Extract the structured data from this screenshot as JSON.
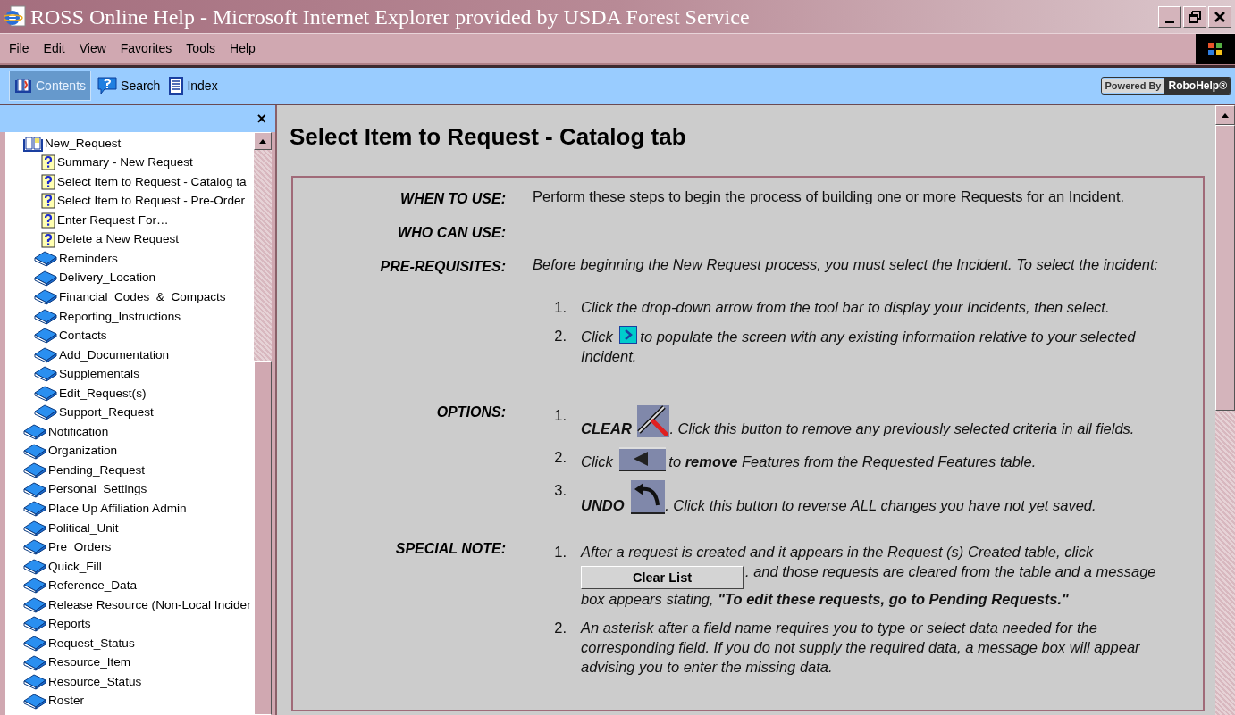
{
  "window": {
    "title": "ROSS Online Help - Microsoft Internet Explorer provided by USDA Forest Service"
  },
  "menu": [
    "File",
    "Edit",
    "View",
    "Favorites",
    "Tools",
    "Help"
  ],
  "tabs": [
    {
      "label": "Contents",
      "selected": true
    },
    {
      "label": "Search",
      "selected": false
    },
    {
      "label": "Index",
      "selected": false
    }
  ],
  "badge": {
    "left": "Powered By",
    "right": "RoboHelp®"
  },
  "sidebar": {
    "close": "×",
    "items": [
      {
        "label": "New_Request",
        "kind": "book",
        "expanded": true,
        "children": [
          {
            "label": "Summary - New Request",
            "kind": "topic"
          },
          {
            "label": "Select Item to Request - Catalog ta",
            "kind": "topic"
          },
          {
            "label": "Select Item to Request - Pre-Order",
            "kind": "topic"
          },
          {
            "label": "Enter Request For…",
            "kind": "topic"
          },
          {
            "label": "Delete a New Request",
            "kind": "topic"
          },
          {
            "label": "Reminders",
            "kind": "book",
            "expanded": false
          },
          {
            "label": "Delivery_Location",
            "kind": "book",
            "expanded": false
          },
          {
            "label": "Financial_Codes_&_Compacts",
            "kind": "book",
            "expanded": false
          },
          {
            "label": "Reporting_Instructions",
            "kind": "book",
            "expanded": false
          },
          {
            "label": "Contacts",
            "kind": "book",
            "expanded": false
          },
          {
            "label": "Add_Documentation",
            "kind": "book",
            "expanded": false
          },
          {
            "label": "Supplementals",
            "kind": "book",
            "expanded": false
          },
          {
            "label": "Edit_Request(s)",
            "kind": "book",
            "expanded": false
          },
          {
            "label": "Support_Request",
            "kind": "book",
            "expanded": false
          }
        ]
      },
      {
        "label": "Notification",
        "kind": "book",
        "expanded": false
      },
      {
        "label": "Organization",
        "kind": "book",
        "expanded": false
      },
      {
        "label": "Pending_Request",
        "kind": "book",
        "expanded": false
      },
      {
        "label": "Personal_Settings",
        "kind": "book",
        "expanded": false
      },
      {
        "label": "Place Up Affiliation Admin",
        "kind": "book",
        "expanded": false
      },
      {
        "label": "Political_Unit",
        "kind": "book",
        "expanded": false
      },
      {
        "label": "Pre_Orders",
        "kind": "book",
        "expanded": false
      },
      {
        "label": "Quick_Fill",
        "kind": "book",
        "expanded": false
      },
      {
        "label": "Reference_Data",
        "kind": "book",
        "expanded": false
      },
      {
        "label": "Release Resource (Non-Local Incider",
        "kind": "book",
        "expanded": false
      },
      {
        "label": "Reports",
        "kind": "book",
        "expanded": false
      },
      {
        "label": "Request_Status",
        "kind": "book",
        "expanded": false
      },
      {
        "label": "Resource_Item",
        "kind": "book",
        "expanded": false
      },
      {
        "label": "Resource_Status",
        "kind": "book",
        "expanded": false
      },
      {
        "label": "Roster",
        "kind": "book",
        "expanded": false
      }
    ]
  },
  "page_title": "Select Item to Request - Catalog tab",
  "sections": [
    {
      "label": "WHEN TO USE:",
      "paragraph": "Perform these steps to begin the process of building one or more Requests for an Incident."
    },
    {
      "label": "WHO CAN USE:"
    },
    {
      "label": "PRE-REQUISITES:",
      "paragraph": "Before beginning the New Request process, you must select the Incident.  To select the incident:",
      "steps": [
        {
          "number": "1.",
          "parts": [
            {
              "kind": "text",
              "text": "Click the drop-down arrow from the tool bar to display your Incidents, then select."
            }
          ]
        },
        {
          "number": "2.",
          "parts": [
            {
              "kind": "text",
              "text": "Click"
            },
            {
              "kind": "next-arrow"
            },
            {
              "kind": "text",
              "text": "to populate the screen with any existing information relative to your selected"
            },
            {
              "kind": "text",
              "text": "Incident."
            }
          ]
        }
      ]
    },
    {
      "label": "OPTIONS:",
      "steps": [
        {
          "number": "1.",
          "parts": [
            {
              "kind": "text",
              "text": "**CLEAR**"
            },
            {
              "kind": "squeegee"
            },
            {
              "kind": "text",
              "text": ".  Click this button to remove any previously selected criteria in all fields."
            }
          ]
        },
        {
          "number": "2.",
          "parts": [
            {
              "kind": "text",
              "text": "Click"
            },
            {
              "kind": "left-arrow"
            },
            {
              "kind": "text",
              "text": "to **remove** Features from the Requested Features table."
            }
          ]
        },
        {
          "number": "3.",
          "parts": [
            {
              "kind": "text",
              "text": "**UNDO**"
            },
            {
              "kind": "undo-arrow"
            },
            {
              "kind": "text",
              "text": ".  Click this button to reverse ALL changes you have not yet saved."
            }
          ]
        }
      ]
    },
    {
      "label": "SPECIAL NOTE:",
      "steps": [
        {
          "number": "1.",
          "parts": [
            {
              "kind": "text",
              "text": "After a request is created and it appears in the Request (s) Created table, click"
            },
            {
              "kind": "button",
              "text": "Clear List"
            },
            {
              "kind": "text",
              "text": ". and those requests are cleared from the table and a message"
            },
            {
              "kind": "text",
              "text": "box appears stating, **\"To edit these requests, go to Pending Requests.\"**"
            }
          ]
        },
        {
          "number": "2.",
          "parts": [
            {
              "kind": "text",
              "text": "An asterisk after a field name requires you to type or select data needed for the corresponding field.  If you do not supply the required data, a message box will appear advising you to enter the missing data."
            }
          ]
        }
      ]
    }
  ]
}
